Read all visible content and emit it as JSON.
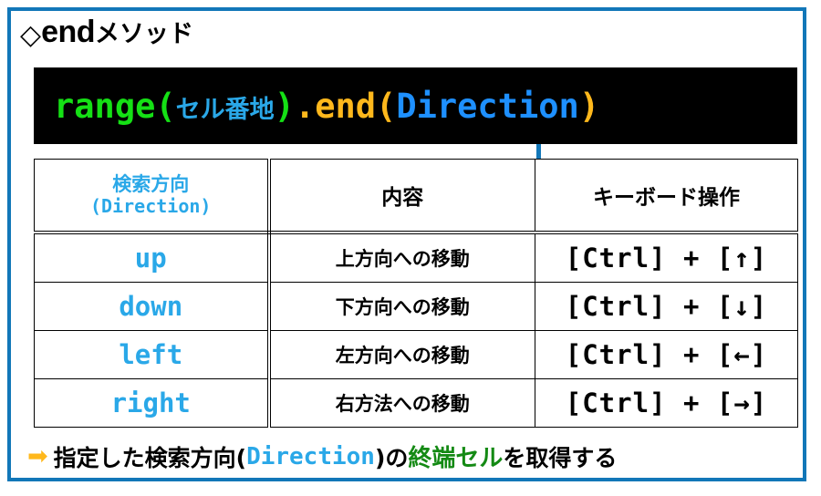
{
  "frame": {
    "border_color": "#1277b8"
  },
  "title": {
    "diamond": "◇",
    "latin": "end",
    "kana": "メソッド"
  },
  "code_bar": {
    "background": "#000000",
    "tokens": {
      "range": "range(",
      "cell_address": "セル番地",
      "close_paren": ")",
      "dot": ".",
      "end": "end(",
      "direction": "Direction",
      "end_paren": ")"
    },
    "colors": {
      "green": "#15e015",
      "cyan": "#2aa8e8",
      "orange": "#ffb81c",
      "blue": "#1e90ff"
    }
  },
  "table": {
    "headers": {
      "direction_line1": "検索方向",
      "direction_line2": "(Direction)",
      "content": "内容",
      "keyboard": "キーボード操作"
    },
    "rows": [
      {
        "direction": "up",
        "content": "上方向への移動",
        "keyboard": "[Ctrl] + [↑]"
      },
      {
        "direction": "down",
        "content": "下方向への移動",
        "keyboard": "[Ctrl] + [↓]"
      },
      {
        "direction": "left",
        "content": "左方向への移動",
        "keyboard": "[Ctrl] + [←]"
      },
      {
        "direction": "right",
        "content": "右方法への移動",
        "keyboard": "[Ctrl] + [→]"
      }
    ]
  },
  "footer": {
    "arrow": "➡",
    "text1": "指定した検索方向(",
    "direction": "Direction",
    "text2": ")の",
    "highlight": "終端セル",
    "text3": "を取得する"
  }
}
